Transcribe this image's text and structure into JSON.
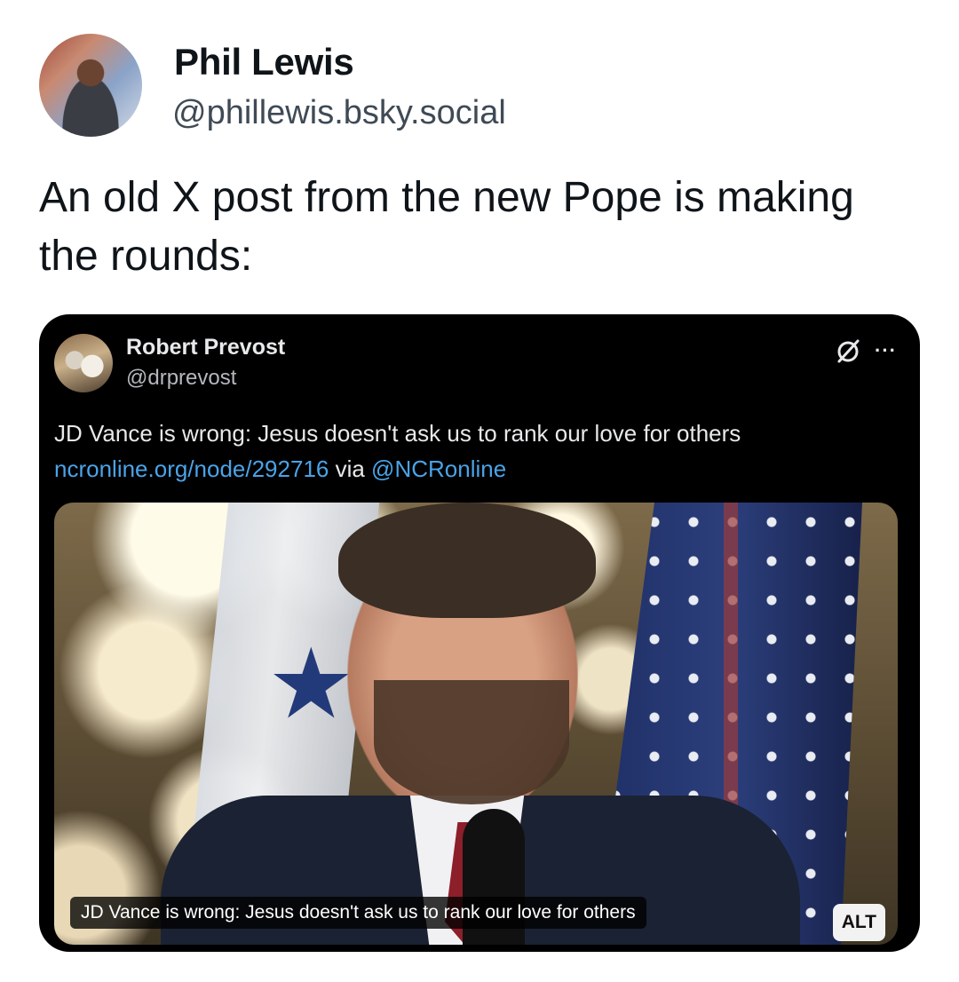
{
  "post": {
    "author_name": "Phil Lewis",
    "author_handle": "@phillewis.bsky.social",
    "text": "An old X post from the new Pope is making the rounds:"
  },
  "quoted_post": {
    "author_name": "Robert Prevost",
    "author_handle": "@drprevost",
    "text_main": "JD Vance is wrong: Jesus doesn't ask us to rank our love for others",
    "link_url": "ncronline.org/node/292716",
    "via_text": " via ",
    "via_handle": "@NCRonline",
    "more_icon": "···",
    "media": {
      "caption": "JD Vance is wrong: Jesus doesn't ask us to rank our love for others",
      "alt_label": "ALT"
    }
  },
  "colors": {
    "link": "#4aa3e8",
    "card_bg": "#000000",
    "handle": "#3f4a55"
  },
  "icons": {
    "avatar": "profile-photo",
    "quote_avatar": "profile-photo",
    "grok": "grok-icon",
    "more": "more-dots-icon"
  }
}
